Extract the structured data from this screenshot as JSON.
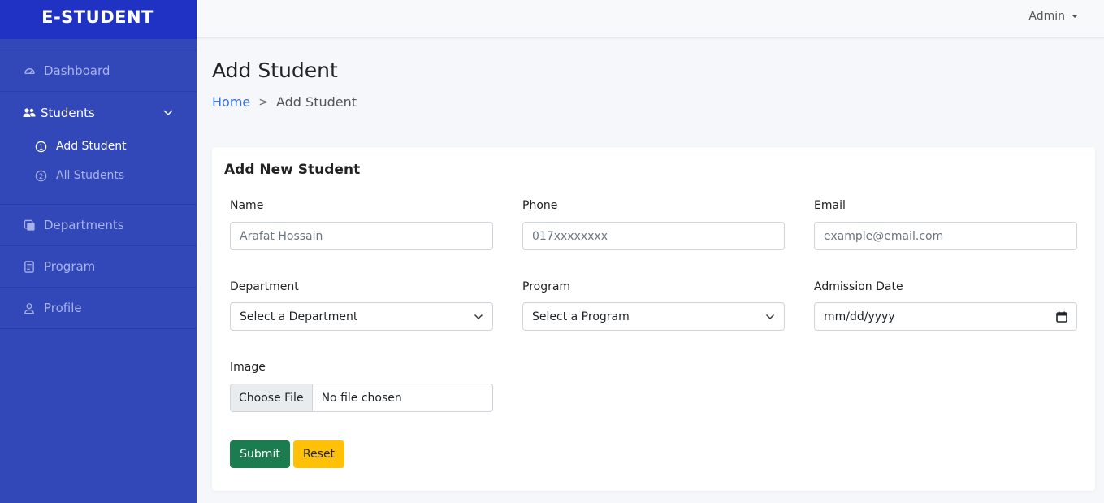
{
  "brand": {
    "name": "E-STUDENT"
  },
  "sidebar": {
    "items": [
      {
        "label": "Dashboard",
        "icon": "dashboard-gauge-icon"
      },
      {
        "label": "Students",
        "icon": "users-icon",
        "expanded": true,
        "children": [
          {
            "label": "Add Student",
            "number": "1",
            "active": true
          },
          {
            "label": "All Students",
            "number": "2",
            "active": false
          }
        ]
      },
      {
        "label": "Departments",
        "icon": "layers-icon"
      },
      {
        "label": "Program",
        "icon": "document-list-icon"
      },
      {
        "label": "Profile",
        "icon": "user-icon"
      }
    ]
  },
  "topbar": {
    "user_label": "Admin"
  },
  "page": {
    "title": "Add Student",
    "breadcrumb": {
      "home": "Home",
      "separator": ">",
      "current": "Add Student"
    }
  },
  "form": {
    "title": "Add New Student",
    "name": {
      "label": "Name",
      "placeholder": "Arafat Hossain"
    },
    "phone": {
      "label": "Phone",
      "placeholder": "017xxxxxxxx"
    },
    "email": {
      "label": "Email",
      "placeholder": "example@email.com"
    },
    "department": {
      "label": "Department",
      "selected": "Select a Department"
    },
    "program": {
      "label": "Program",
      "selected": "Select a Program"
    },
    "admission_date": {
      "label": "Admission Date",
      "placeholder": "mm/dd/yyyy"
    },
    "image": {
      "label": "Image",
      "button": "Choose File",
      "status": "No file chosen"
    },
    "submit_label": "Submit",
    "reset_label": "Reset"
  },
  "colors": {
    "sidebar_bg": "#3248b8",
    "brand_bg": "#2032c4",
    "submit": "#1b7d4f",
    "reset": "#ffc107",
    "link": "#2f6fe0"
  }
}
